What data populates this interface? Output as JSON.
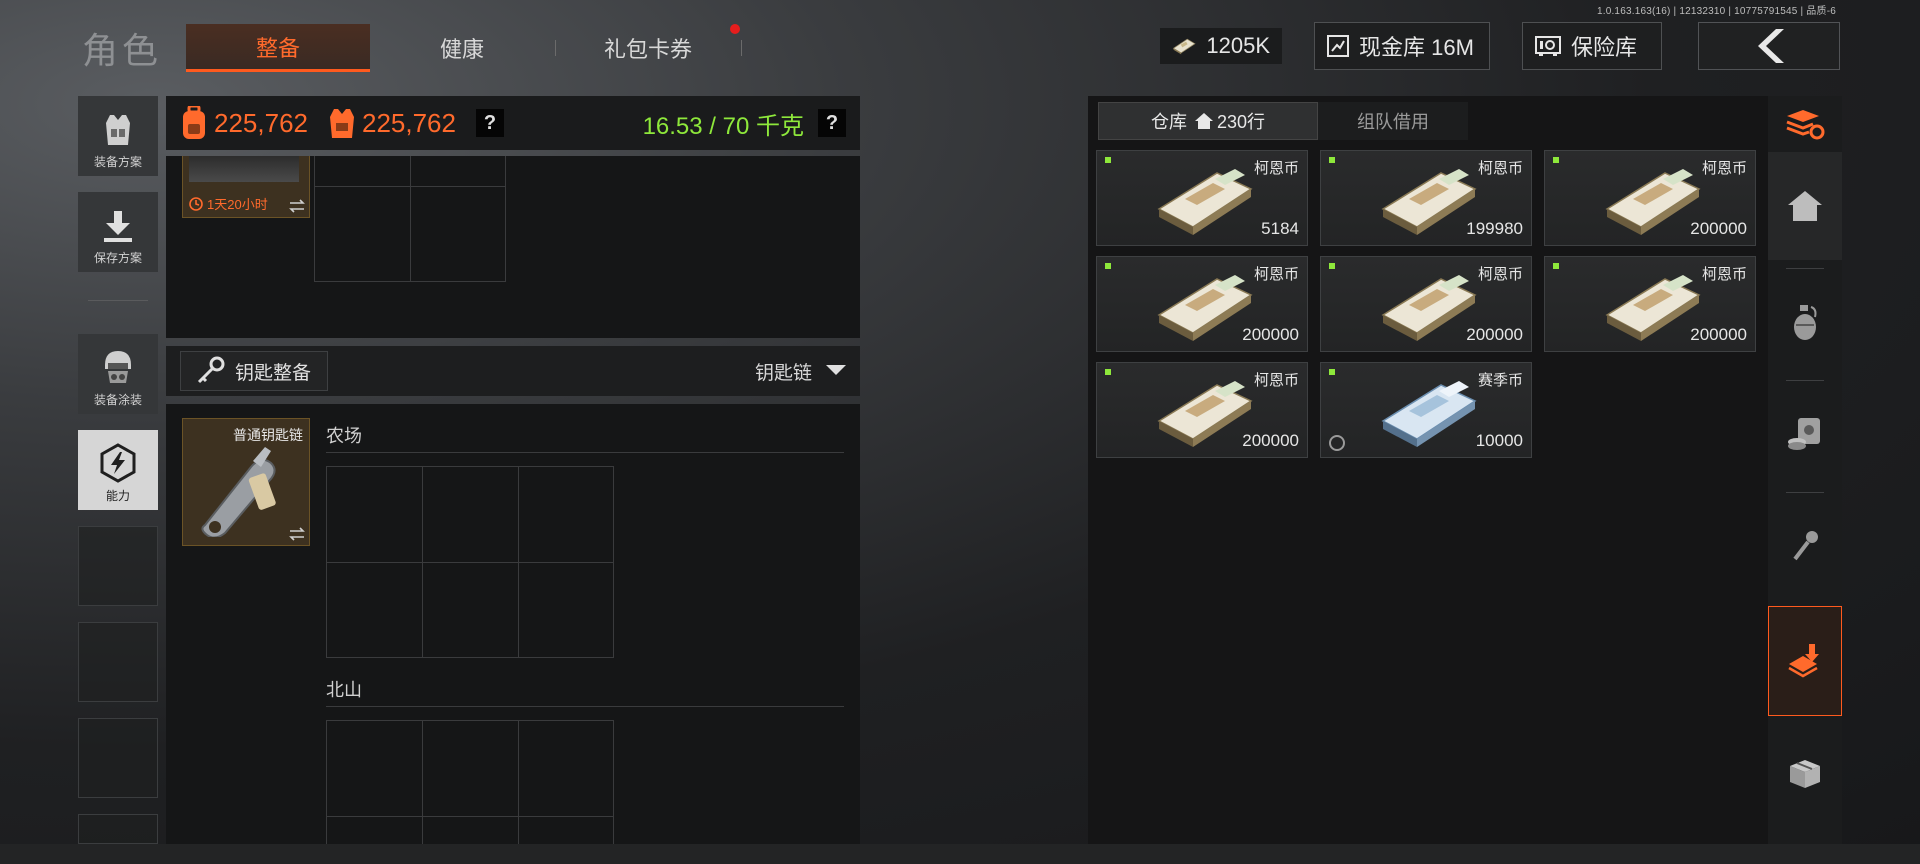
{
  "version_text": "1.0.163.163(16) | 12132310 | 10775791545 | 品质-6",
  "header": {
    "title": "角色",
    "tabs": [
      {
        "label": "整备",
        "active": true
      },
      {
        "label": "健康",
        "active": false
      },
      {
        "label": "礼包卡券",
        "active": false,
        "has_notification": true
      }
    ],
    "currency": "1205K",
    "cash_vault": "现金库 16M",
    "safe": "保险库"
  },
  "left_menu": {
    "items": [
      {
        "label": "装备方案",
        "icon": "vest-icon"
      },
      {
        "label": "保存方案",
        "icon": "download-icon"
      },
      {
        "label": "装备涂装",
        "icon": "helmet-icon"
      },
      {
        "label": "能力",
        "icon": "ability-icon",
        "active": true
      }
    ]
  },
  "equipment": {
    "backpack_value": "225,762",
    "vest_value": "225,762",
    "help_mark": "?",
    "weight": "16.53 / 70 千克",
    "item_timer": "1天20小时"
  },
  "keys": {
    "title": "钥匙整备",
    "dropdown": "钥匙链",
    "item_name": "普通钥匙链",
    "sections": [
      {
        "label": "农场"
      },
      {
        "label": "北山"
      }
    ]
  },
  "warehouse": {
    "tab_active": "仓库",
    "rows": "230行",
    "tab_other": "组队借用",
    "items": [
      {
        "name": "柯恩币",
        "count": "5184",
        "type": "cash"
      },
      {
        "name": "柯恩币",
        "count": "199980",
        "type": "cash"
      },
      {
        "name": "柯恩币",
        "count": "200000",
        "type": "cash"
      },
      {
        "name": "柯恩币",
        "count": "200000",
        "type": "cash"
      },
      {
        "name": "柯恩币",
        "count": "200000",
        "type": "cash"
      },
      {
        "name": "柯恩币",
        "count": "200000",
        "type": "cash"
      },
      {
        "name": "柯恩币",
        "count": "200000",
        "type": "cash"
      },
      {
        "name": "赛季币",
        "count": "10000",
        "type": "season"
      }
    ]
  },
  "colors": {
    "accent": "#ff6a2c",
    "weight_green": "#8ee83b",
    "notification_red": "#e51d1d"
  },
  "rail_icons": [
    "collection-refresh-icon",
    "home-icon",
    "grenade-icon",
    "cash-box-icon",
    "key-icon",
    "deposit-icon",
    "crate-icon"
  ]
}
